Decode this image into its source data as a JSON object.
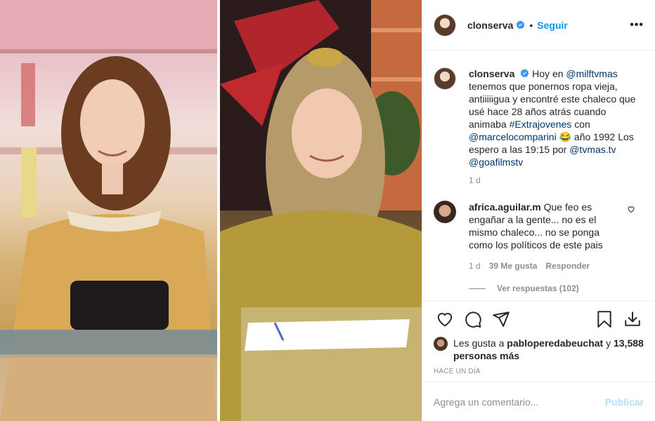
{
  "post": {
    "username": "clonserva",
    "follow_label": "Seguir",
    "more_label": "•••",
    "caption": {
      "username": "clonserva",
      "parts": [
        {
          "t": "Hoy en ",
          "link": false
        },
        {
          "t": "@milftvmas",
          "link": true
        },
        {
          "t": " tenemos que ponernos ropa vieja, antiiiiigua y encontré este chaleco que usé hace 28 años atrás cuando animaba ",
          "link": false
        },
        {
          "t": "#Extrajovenes",
          "link": true
        },
        {
          "t": " con ",
          "link": false
        },
        {
          "t": "@marcelocomparini",
          "link": true
        },
        {
          "t": " 😂 año 1992 Los espero a las 19:15 por ",
          "link": false
        },
        {
          "t": "@tvmas.tv",
          "link": true
        },
        {
          "t": " ",
          "link": false
        },
        {
          "t": "@goafilmstv",
          "link": true
        }
      ],
      "time": "1 d"
    },
    "comment": {
      "username": "africa.aguilar.m",
      "text": "Que feo es engañar a la gente... no es el mismo chaleco... no se ponga como los políticos de este pais",
      "time": "1 d",
      "likes": "39 Me gusta",
      "reply": "Responder",
      "view_replies": "Ver respuestas (102)"
    },
    "likes": {
      "prefix": "Les gusta a ",
      "user": "pabloperedabeuchat",
      "middle": " y ",
      "count": "13,588 personas más"
    },
    "timestamp": "Hace un día",
    "add_comment": {
      "placeholder": "Agrega un comentario...",
      "post_label": "Publicar"
    },
    "colors": {
      "accent": "#0095f6",
      "link": "#00376b",
      "muted": "#8e8e8e",
      "post_disabled": "#b2dffc",
      "verified": "#3897f0"
    },
    "icons": [
      "heart-icon",
      "comment-icon",
      "share-icon",
      "bookmark-icon",
      "download-icon",
      "verified-icon",
      "more-icon"
    ]
  }
}
